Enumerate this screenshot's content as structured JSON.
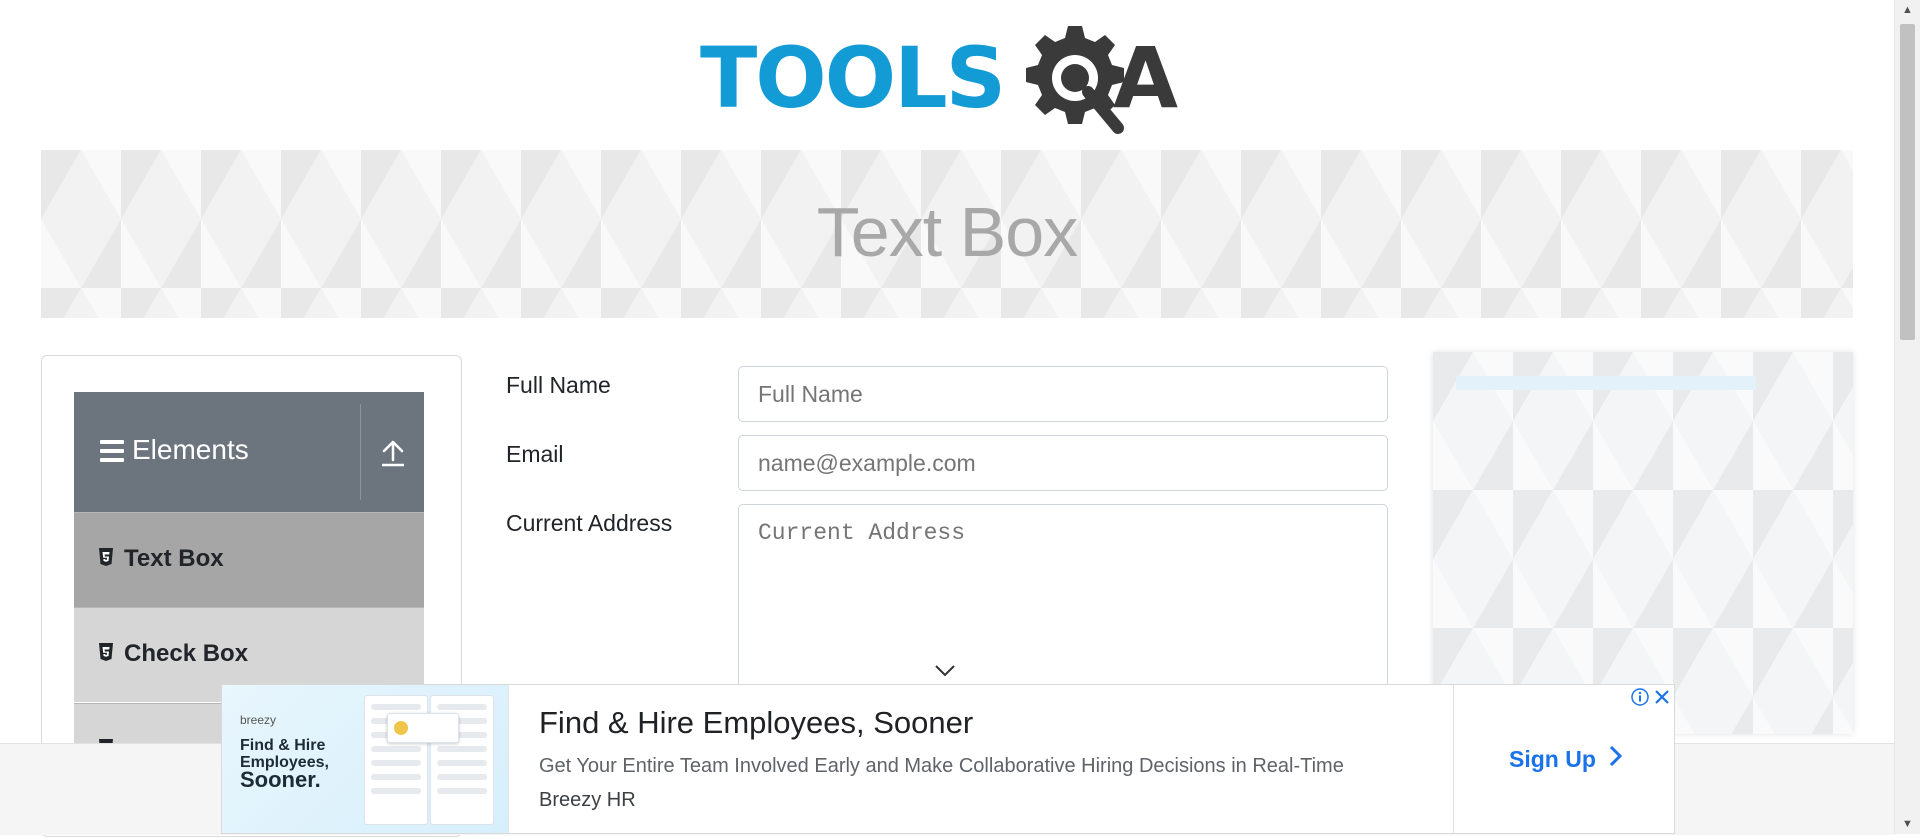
{
  "header": {
    "logo_text_primary": "TOOLS",
    "logo_text_secondary": "A",
    "logo_name": "ToolsQA"
  },
  "banner": {
    "title": "Text Box"
  },
  "sidebar": {
    "group_title": "Elements",
    "items": [
      {
        "label": "Text Box",
        "active": true
      },
      {
        "label": "Check Box",
        "active": false
      },
      {
        "label": "",
        "active": false
      }
    ]
  },
  "form": {
    "full_name": {
      "label": "Full Name",
      "placeholder": "Full Name",
      "value": ""
    },
    "email": {
      "label": "Email",
      "placeholder": "name@example.com",
      "value": ""
    },
    "current_address": {
      "label": "Current Address",
      "placeholder": "Current Address",
      "value": ""
    }
  },
  "bottom_ad": {
    "brand": "breezy",
    "thumb_tagline_1": "Find & Hire",
    "thumb_tagline_2": "Employees,",
    "thumb_tagline_3": "Sooner.",
    "headline": "Find & Hire Employees, Sooner",
    "description": "Get Your Entire Team Involved Early and Make Collaborative Hiring Decisions in Real-Time",
    "advertiser": "Breezy HR",
    "cta": "Sign Up"
  },
  "colors": {
    "logo_blue": "#139bd5",
    "logo_dark": "#3a3a3a",
    "group_header_bg": "#6c757d",
    "active_item_bg": "#a6a6a6",
    "item_bg": "#d6d6d6",
    "cta_blue": "#1a73e8"
  },
  "icons": {
    "menu": "hamburger-icon",
    "collapse": "upload-arrow-icon",
    "item": "html5-icon",
    "ad_info": "info-icon",
    "ad_close": "close-icon",
    "cta": "chevron-right-icon",
    "textarea": "chevron-down-icon"
  }
}
